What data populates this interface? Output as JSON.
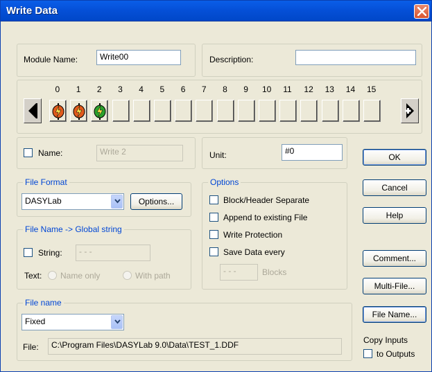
{
  "window": {
    "title": "Write Data"
  },
  "module": {
    "name_label": "Module Name:",
    "name_value": "Write00",
    "description_label": "Description:",
    "description_value": ""
  },
  "channels": {
    "numbers": [
      "0",
      "1",
      "2",
      "3",
      "4",
      "5",
      "6",
      "7",
      "8",
      "9",
      "10",
      "11",
      "12",
      "13",
      "14",
      "15"
    ],
    "connected": [
      {
        "index": 0,
        "color": "#e05a1c"
      },
      {
        "index": 1,
        "color": "#e05a1c"
      },
      {
        "index": 2,
        "color": "#2ca02c"
      }
    ]
  },
  "name_row": {
    "checkbox_label": "Name:",
    "name_value": "Write 2",
    "unit_label": "Unit:",
    "unit_value": "#0"
  },
  "file_format": {
    "legend": "File Format",
    "selected": "DASYLab",
    "options_button": "Options..."
  },
  "global_string": {
    "legend": "File Name -> Global string",
    "string_label": "String:",
    "string_value": "- - -",
    "text_label": "Text:",
    "radio_name_only": "Name only",
    "radio_with_path": "With path"
  },
  "options": {
    "legend": "Options",
    "block_header": "Block/Header Separate",
    "append": "Append to existing File",
    "write_protection": "Write Protection",
    "save_data_every": "Save Data every",
    "blocks_value": "- - -",
    "blocks_label": "Blocks"
  },
  "file_name": {
    "legend": "File name",
    "selected": "Fixed",
    "file_label": "File:",
    "file_path": "C:\\Program Files\\DASYLab 9.0\\Data\\TEST_1.DDF"
  },
  "buttons": {
    "ok": "OK",
    "cancel": "Cancel",
    "help": "Help",
    "comment": "Comment...",
    "multi_file": "Multi-File...",
    "file_name": "File Name..."
  },
  "copy_inputs": {
    "line1": "Copy Inputs",
    "line2": "to Outputs"
  },
  "colors": {
    "titlebar": "#0550d8",
    "legend": "#0046d5",
    "dialog_bg": "#ece9d8"
  }
}
